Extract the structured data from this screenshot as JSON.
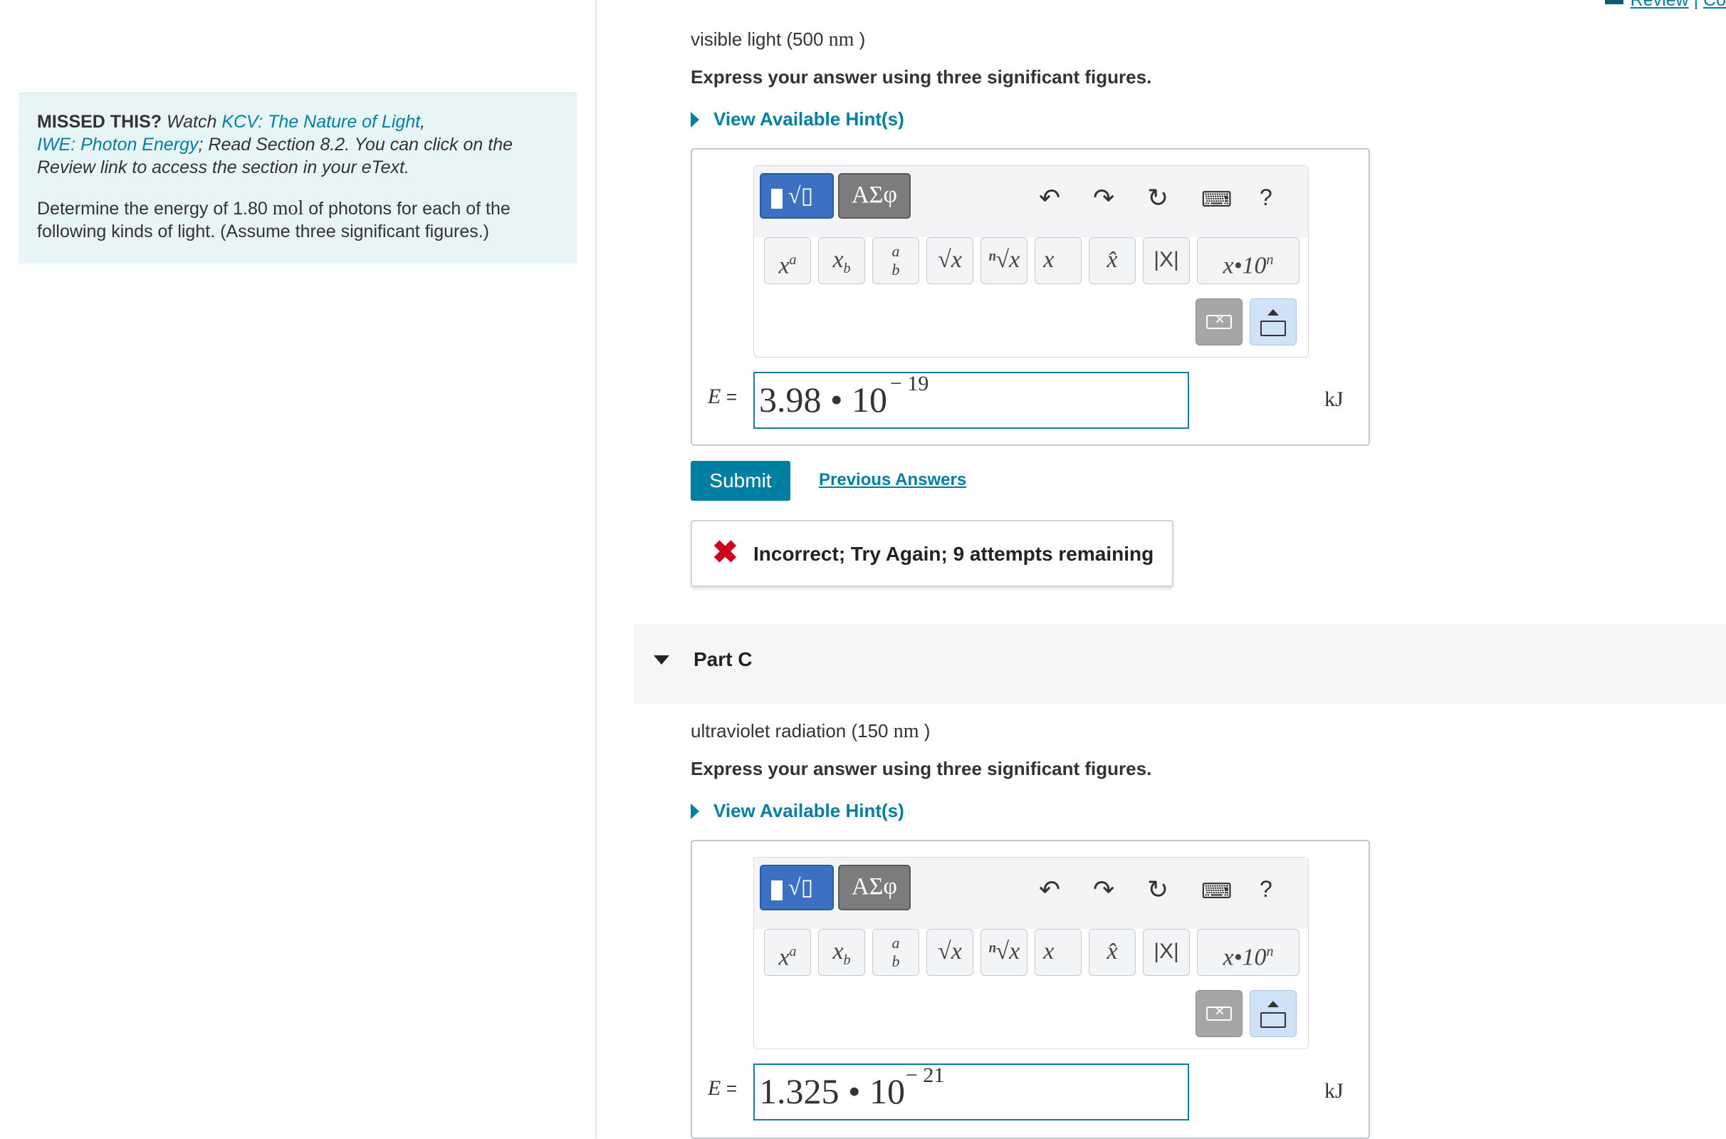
{
  "header": {
    "review_label": "Review",
    "separator": "|",
    "constants_label": "Co"
  },
  "left_panel": {
    "missed_label": "MISSED THIS?",
    "watch_label": " Watch ",
    "link1": "KCV: The Nature of Light",
    "comma": ",",
    "link2": "IWE: Photon Energy",
    "read_text": "; Read Section 8.2. You can click on the Review link to access the section in your eText.",
    "determine_pre": "Determine the energy of 1.80 ",
    "determine_unit": "mol",
    "determine_post": " of photons for each of the following kinds of light. (Assume three significant figures.)"
  },
  "part_b": {
    "question_prefix": "visible light (500 ",
    "question_unit": "nm",
    "question_suffix": " )",
    "instruction": "Express your answer using three significant figures.",
    "hint_label": "View Available Hint(s)",
    "answer_mantissa": "3.98 • 10",
    "answer_exponent": "− 19",
    "unit": "kJ"
  },
  "editor": {
    "greek_label": "ΑΣφ",
    "help_label": "?",
    "keys": [
      "xa",
      "xb",
      "a/b",
      "√x",
      "n√x",
      "x→",
      "x̂",
      "|X|",
      "x•10n"
    ]
  },
  "submit_label": "Submit",
  "previous_answers_label": "Previous Answers",
  "feedback": {
    "icon": "✖",
    "message": "Incorrect; Try Again; 9 attempts remaining"
  },
  "part_c": {
    "title": "Part C",
    "question_prefix": "ultraviolet radiation (150 ",
    "question_unit": "nm",
    "question_suffix": " )",
    "instruction": "Express your answer using three significant figures.",
    "hint_label": "View Available Hint(s)",
    "answer_mantissa": "1.325 • 10",
    "answer_exponent": "− 21",
    "unit": "kJ"
  },
  "colors": {
    "accent": "#007fa3",
    "error": "#d0021b",
    "panel_bg": "#e8f5f6"
  }
}
